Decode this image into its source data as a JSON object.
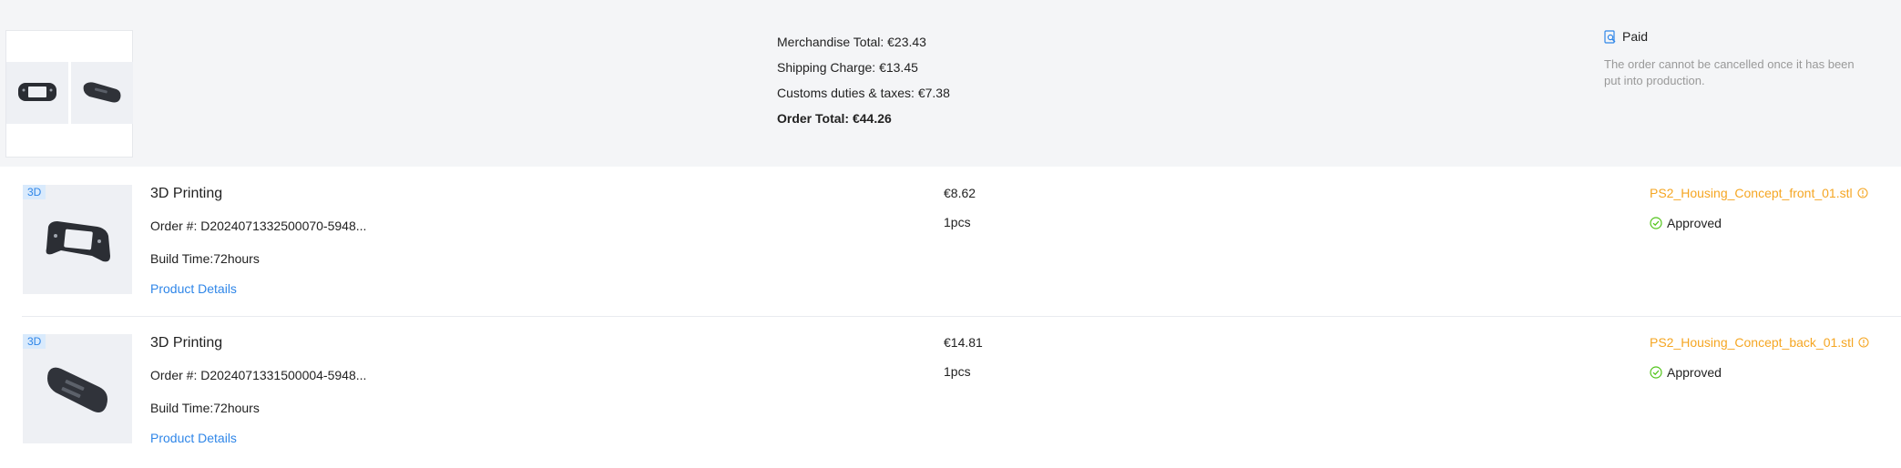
{
  "summary": {
    "merchandise_total": "Merchandise Total: €23.43",
    "shipping_charge": "Shipping Charge: €13.45",
    "customs": "Customs duties & taxes: €7.38",
    "order_total": "Order Total: €44.26",
    "payment_status": "Paid",
    "note": "The order cannot be cancelled once it has been put into production."
  },
  "items": [
    {
      "tag": "3D",
      "title": "3D Printing",
      "order_number": "Order #: D2024071332500070-5948...",
      "build_time": "Build Time:72hours",
      "details_link": "Product Details",
      "price": "€8.62",
      "quantity": "1pcs",
      "file_name": "PS2_Housing_Concept_front_01.stl",
      "status": "Approved"
    },
    {
      "tag": "3D",
      "title": "3D Printing",
      "order_number": "Order #: D2024071331500004-5948...",
      "build_time": "Build Time:72hours",
      "details_link": "Product Details",
      "price": "€14.81",
      "quantity": "1pcs",
      "file_name": "PS2_Housing_Concept_back_01.stl",
      "status": "Approved"
    }
  ],
  "icons": {
    "paid": "receipt-search-icon",
    "info": "info-circle-icon",
    "approved": "check-circle-icon"
  },
  "colors": {
    "accent_blue": "#2f86e8",
    "file_orange": "#f5a623",
    "approved_green": "#52c41a",
    "summary_bg": "#f4f5f7"
  }
}
